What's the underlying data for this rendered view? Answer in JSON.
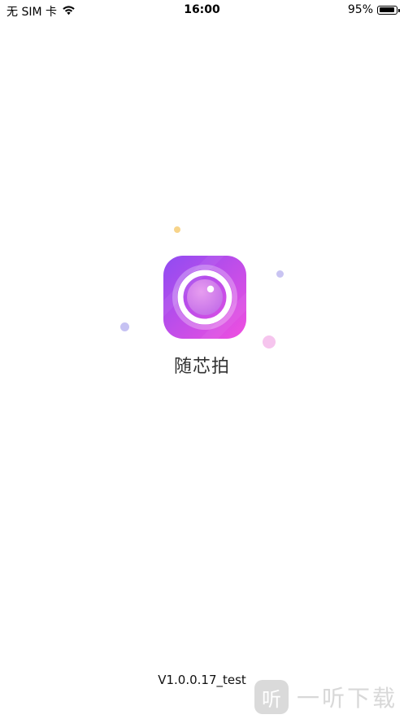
{
  "status_bar": {
    "carrier": "无 SIM 卡",
    "time": "16:00",
    "battery_percent": "95%",
    "battery_level": 0.95,
    "wifi_icon": "wifi-icon",
    "battery_icon": "battery-icon"
  },
  "splash": {
    "app_name": "随芯拍",
    "app_icon": "camera-lens-icon",
    "colors": {
      "icon_gradient_start": "#8f4cf2",
      "icon_gradient_end": "#f04fe0"
    }
  },
  "footer": {
    "version": "V1.0.0.17_test"
  },
  "watermark": {
    "badge": "听",
    "text": "一听下载"
  }
}
